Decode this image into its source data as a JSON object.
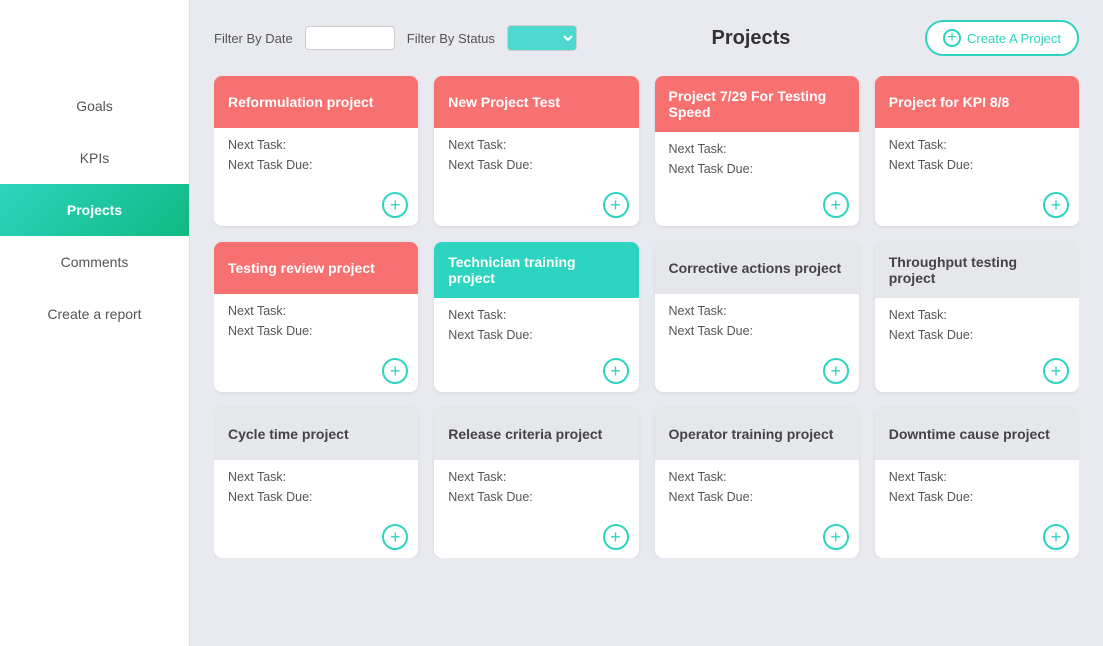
{
  "sidebar": {
    "items": [
      {
        "label": "Goals",
        "active": false
      },
      {
        "label": "KPIs",
        "active": false
      },
      {
        "label": "Projects",
        "active": true
      },
      {
        "label": "Comments",
        "active": false
      },
      {
        "label": "Create a report",
        "active": false
      }
    ]
  },
  "header": {
    "title": "Projects",
    "filter_date_label": "Filter By Date",
    "filter_status_label": "Filter By Status",
    "create_button": "Create A Project",
    "date_placeholder": "",
    "status_placeholder": ""
  },
  "cards": [
    {
      "title": "Reformulation project",
      "color": "red",
      "next_task_label": "Next Task:",
      "next_task_due_label": "Next Task Due:"
    },
    {
      "title": "New Project Test",
      "color": "red",
      "next_task_label": "Next Task:",
      "next_task_due_label": "Next Task Due:"
    },
    {
      "title": "Project 7/29 For Testing Speed",
      "color": "red",
      "next_task_label": "Next Task:",
      "next_task_due_label": "Next Task Due:"
    },
    {
      "title": "Project for KPI 8/8",
      "color": "red",
      "next_task_label": "Next Task:",
      "next_task_due_label": "Next Task Due:"
    },
    {
      "title": "Testing review project",
      "color": "red",
      "next_task_label": "Next Task:",
      "next_task_due_label": "Next Task Due:"
    },
    {
      "title": "Technician training project",
      "color": "teal",
      "next_task_label": "Next Task:",
      "next_task_due_label": "Next Task Due:"
    },
    {
      "title": "Corrective actions project",
      "color": "gray",
      "next_task_label": "Next Task:",
      "next_task_due_label": "Next Task Due:"
    },
    {
      "title": "Throughput testing project",
      "color": "gray",
      "next_task_label": "Next Task:",
      "next_task_due_label": "Next Task Due:"
    },
    {
      "title": "Cycle time project",
      "color": "gray",
      "next_task_label": "Next Task:",
      "next_task_due_label": "Next Task Due:"
    },
    {
      "title": "Release criteria project",
      "color": "gray",
      "next_task_label": "Next Task:",
      "next_task_due_label": "Next Task Due:"
    },
    {
      "title": "Operator training project",
      "color": "gray",
      "next_task_label": "Next Task:",
      "next_task_due_label": "Next Task Due:"
    },
    {
      "title": "Downtime cause project",
      "color": "gray",
      "next_task_label": "Next Task:",
      "next_task_due_label": "Next Task Due:"
    }
  ]
}
